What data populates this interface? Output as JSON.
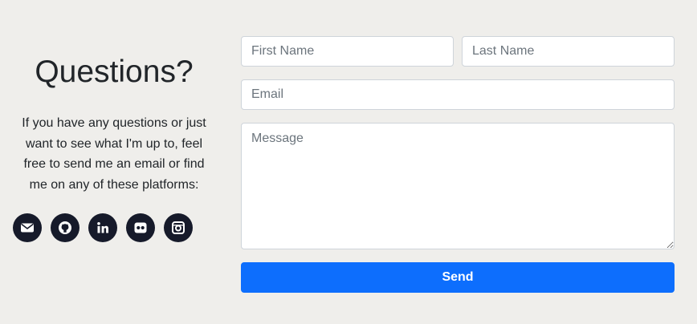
{
  "contact": {
    "title": "Questions?",
    "intro": "If you have any questions or just want to see what I'm up to, feel free to send me an email or find me on any of these platforms:",
    "socials": [
      {
        "icon": "envelope-icon"
      },
      {
        "icon": "github-icon"
      },
      {
        "icon": "linkedin-icon"
      },
      {
        "icon": "flickr-icon"
      },
      {
        "icon": "instagram-icon"
      }
    ]
  },
  "form": {
    "first_name": {
      "placeholder": "First Name",
      "value": ""
    },
    "last_name": {
      "placeholder": "Last Name",
      "value": ""
    },
    "email": {
      "placeholder": "Email",
      "value": ""
    },
    "message": {
      "placeholder": "Message",
      "value": ""
    },
    "send_label": "Send"
  },
  "colors": {
    "page_background": "#efeeeb",
    "accent": "#0d6efd",
    "icon_circle": "#161a2a"
  }
}
